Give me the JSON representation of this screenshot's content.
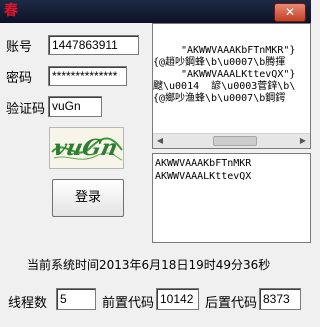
{
  "window": {
    "app_icon_glyph": "春",
    "close_glyph": "✕"
  },
  "form": {
    "account_label": "账号",
    "account_value": "1447863911",
    "password_label": "密码",
    "password_value": "**************",
    "captcha_label": "验证码",
    "captcha_value": "vuGn",
    "captcha_image_text": "vuGn",
    "login_label": "登录"
  },
  "log": {
    "lines": [
      "\"AKWWVAAAKbFTnMKR\"}",
      "{@趙吵鋼蜂\\b\\u0007\\b腾揮",
      "\"AKWWVAAALKttevQX\"}",
      "颼\\u0014  諺\\u0003菅鋅\\b\\",
      "{@鄉吵渔蜂\\b\\u0007\\b鋼鍔"
    ]
  },
  "output": {
    "lines": [
      "AKWWVAAAKbFTnMKR",
      "AKWWVAAALKttevQX"
    ]
  },
  "status": {
    "time_text": "当前系统时间2013年6月18日19时49分36秒"
  },
  "settings": {
    "threads_label": "线程数",
    "threads_value": "5",
    "prefix_label": "前置代码",
    "prefix_value": "10142",
    "suffix_label": "后置代码",
    "suffix_value": "8373"
  }
}
